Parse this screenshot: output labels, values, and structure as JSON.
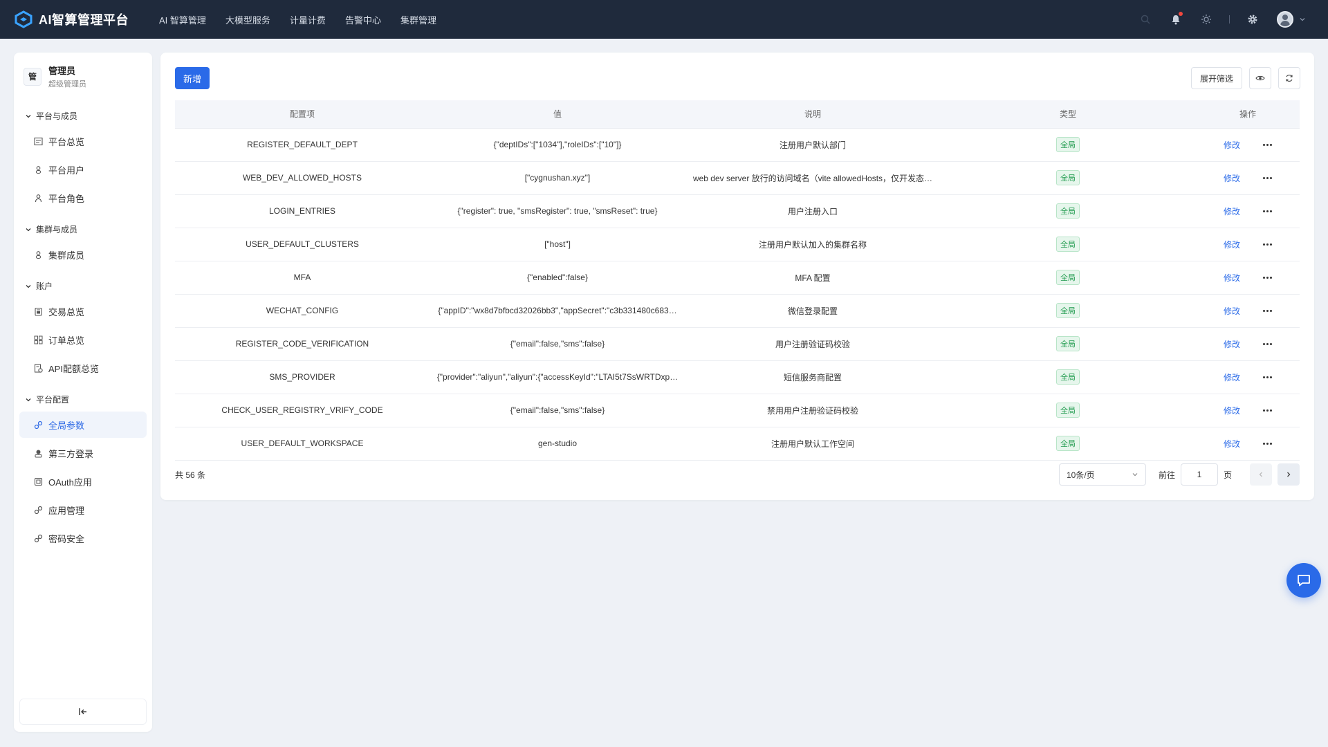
{
  "app": {
    "title": "AI智算管理平台"
  },
  "topnav": [
    "AI 智算管理",
    "大模型服务",
    "计量计费",
    "告警中心",
    "集群管理"
  ],
  "user": {
    "badge": "管",
    "name": "管理员",
    "role": "超级管理员"
  },
  "sidebar": {
    "groups": [
      {
        "title": "平台与成员",
        "items": [
          {
            "label": "平台总览",
            "icon": "dashboard-icon"
          },
          {
            "label": "平台用户",
            "icon": "user-icon"
          },
          {
            "label": "平台角色",
            "icon": "role-icon"
          }
        ]
      },
      {
        "title": "集群与成员",
        "items": [
          {
            "label": "集群成员",
            "icon": "user-icon"
          }
        ]
      },
      {
        "title": "账户",
        "items": [
          {
            "label": "交易总览",
            "icon": "wallet-icon"
          },
          {
            "label": "订单总览",
            "icon": "grid-icon"
          },
          {
            "label": "API配额总览",
            "icon": "report-icon"
          }
        ]
      },
      {
        "title": "平台配置",
        "items": [
          {
            "label": "全局参数",
            "icon": "link-icon",
            "active": true
          },
          {
            "label": "第三方登录",
            "icon": "login-icon"
          },
          {
            "label": "OAuth应用",
            "icon": "app-icon"
          },
          {
            "label": "应用管理",
            "icon": "link-icon"
          },
          {
            "label": "密码安全",
            "icon": "link-icon"
          }
        ]
      }
    ],
    "collapse_icon": "collapse-left-icon"
  },
  "toolbar": {
    "add_label": "新增",
    "filter_label": "展开筛选"
  },
  "table": {
    "headers": [
      "配置项",
      "值",
      "说明",
      "类型",
      "操作"
    ],
    "edit_label": "修改",
    "rows": [
      {
        "key": "REGISTER_DEFAULT_DEPT",
        "value": "{\"deptIDs\":[\"1034\"],\"roleIDs\":[\"10\"]}",
        "desc": "注册用户默认部门",
        "type": "全局"
      },
      {
        "key": "WEB_DEV_ALLOWED_HOSTS",
        "value": "[\"cygnushan.xyz\"]",
        "desc": "web dev server 放行的访问域名（vite allowedHosts，仅开发态…",
        "type": "全局"
      },
      {
        "key": "LOGIN_ENTRIES",
        "value": "{\"register\": true, \"smsRegister\": true, \"smsReset\": true}",
        "desc": "用户注册入口",
        "type": "全局"
      },
      {
        "key": "USER_DEFAULT_CLUSTERS",
        "value": "[\"host\"]",
        "desc": "注册用户默认加入的集群名称",
        "type": "全局"
      },
      {
        "key": "MFA",
        "value": "{\"enabled\":false}",
        "desc": "MFA 配置",
        "type": "全局"
      },
      {
        "key": "WECHAT_CONFIG",
        "value": "{\"appID\":\"wx8d7bfbcd32026bb3\",\"appSecret\":\"c3b331480c683…",
        "desc": "微信登录配置",
        "type": "全局"
      },
      {
        "key": "REGISTER_CODE_VERIFICATION",
        "value": "{\"email\":false,\"sms\":false}",
        "desc": "用户注册验证码校验",
        "type": "全局"
      },
      {
        "key": "SMS_PROVIDER",
        "value": "{\"provider\":\"aliyun\",\"aliyun\":{\"accessKeyId\":\"LTAI5t7SsWRTDxp…",
        "desc": "短信服务商配置",
        "type": "全局"
      },
      {
        "key": "CHECK_USER_REGISTRY_VRIFY_CODE",
        "value": "{\"email\":false,\"sms\":false}",
        "desc": "禁用用户注册验证码校验",
        "type": "全局"
      },
      {
        "key": "USER_DEFAULT_WORKSPACE",
        "value": "gen-studio",
        "desc": "注册用户默认工作空间",
        "type": "全局"
      }
    ]
  },
  "pager": {
    "total": "共 56 条",
    "page_size": "10条/页",
    "goto_label": "前往",
    "page_value": "1",
    "page_suffix": "页"
  },
  "colors": {
    "topbar": "#1f2a3c",
    "accent": "#2a6ae8",
    "tag_green": "#1f9a4d"
  }
}
